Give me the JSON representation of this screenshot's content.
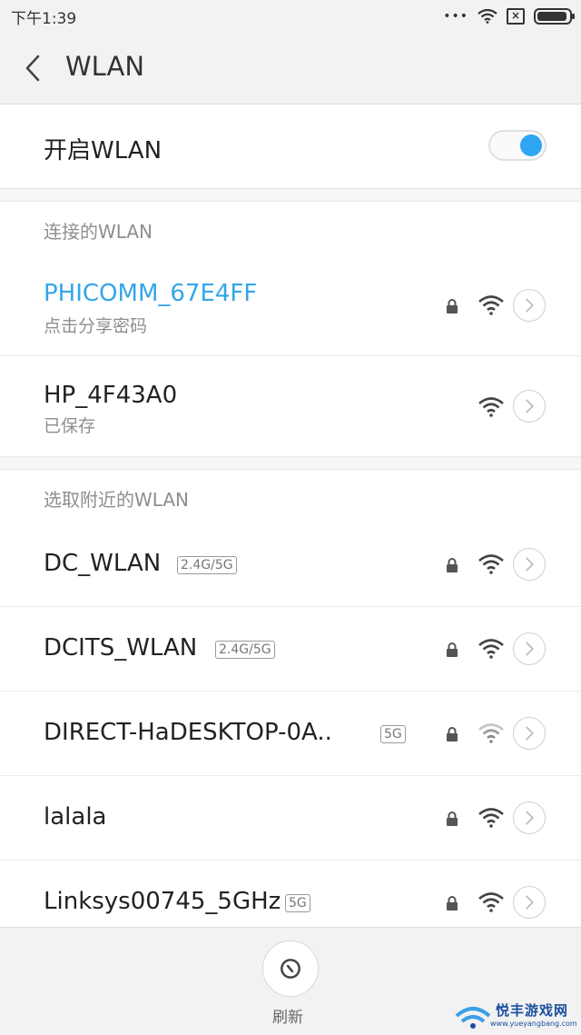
{
  "status_bar": {
    "time": "下午1:39",
    "more": "•••"
  },
  "header": {
    "title": "WLAN"
  },
  "wlan_toggle": {
    "label": "开启WLAN",
    "enabled": true,
    "accent": "#2fa6f2"
  },
  "connected_section": {
    "title": "连接的WLAN",
    "networks": [
      {
        "name": "PHICOMM_67E4FF",
        "subtitle": "点击分享密码",
        "locked": true,
        "name_color": "#35a5e8"
      },
      {
        "name": "HP_4F43A0",
        "subtitle": "已保存",
        "locked": false
      }
    ]
  },
  "nearby_section": {
    "title": "选取附近的WLAN",
    "networks": [
      {
        "name": "DC_WLAN",
        "badge": "2.4G/5G",
        "locked": true
      },
      {
        "name": "DCITS_WLAN",
        "badge": "2.4G/5G",
        "locked": true
      },
      {
        "name": "DIRECT-HaDESKTOP-0A..",
        "badge": "5G",
        "locked": true
      },
      {
        "name": "lalala",
        "badge": "",
        "locked": true
      },
      {
        "name": "Linksys00745_5GHz",
        "badge": "5G",
        "locked": true
      }
    ]
  },
  "bottom_bar": {
    "refresh_label": "刷新"
  },
  "watermark": {
    "text": "悦丰游戏网",
    "url": "www.yueyangbang.com"
  }
}
